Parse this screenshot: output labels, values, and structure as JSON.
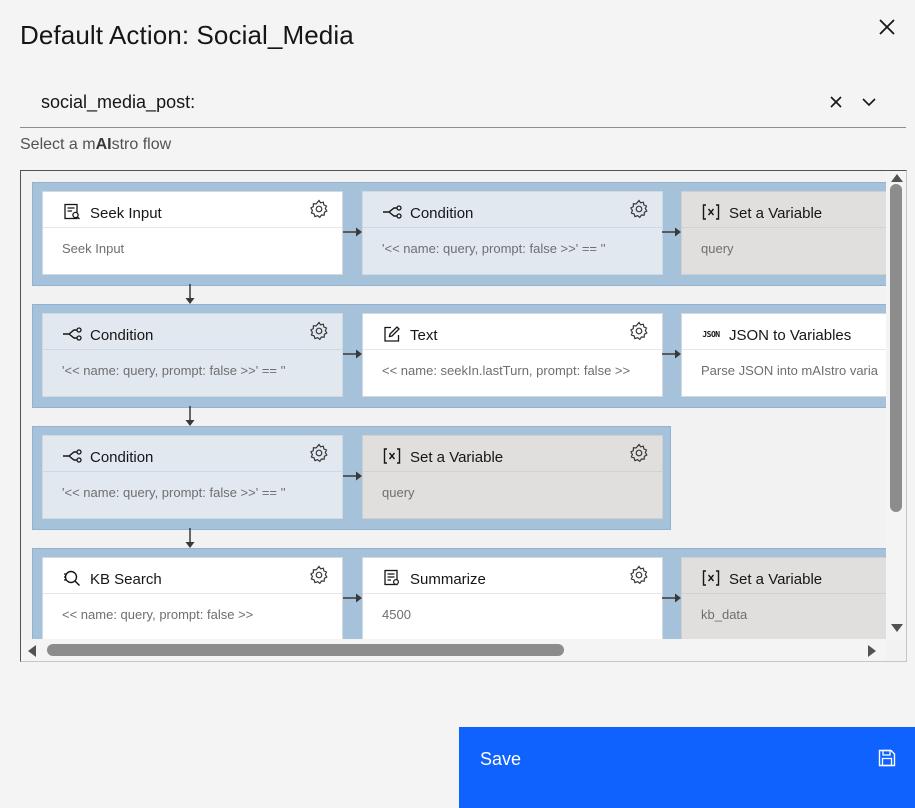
{
  "dialog": {
    "title": "Default Action: Social_Media"
  },
  "dropdown": {
    "value": "social_media_post:"
  },
  "helper": {
    "prefix": "Select a m",
    "brand": "AI",
    "suffix": "stro flow"
  },
  "flow": {
    "rows": [
      {
        "cards": [
          {
            "type": "seek",
            "icon": "seek-input-icon",
            "title": "Seek Input",
            "body": "Seek Input"
          },
          {
            "type": "cond",
            "icon": "branch-icon",
            "title": "Condition",
            "body": "'<< name: query, prompt: false >>' == ''"
          },
          {
            "type": "var",
            "icon": "variable-icon",
            "title": "Set a Variable",
            "body": "query"
          }
        ]
      },
      {
        "cards": [
          {
            "type": "cond",
            "icon": "branch-icon",
            "title": "Condition",
            "body": "'<< name: query, prompt: false >>' == ''"
          },
          {
            "type": "text",
            "icon": "edit-icon",
            "title": "Text",
            "body": "<< name: seekIn.lastTurn, prompt: false >>"
          },
          {
            "type": "json",
            "icon": "json-icon",
            "title": "JSON to Variables",
            "body": "Parse JSON into mAIstro varia"
          }
        ]
      },
      {
        "cards": [
          {
            "type": "cond",
            "icon": "branch-icon",
            "title": "Condition",
            "body": "'<< name: query, prompt: false >>' == ''"
          },
          {
            "type": "var",
            "icon": "variable-icon",
            "title": "Set a Variable",
            "body": "query"
          }
        ]
      },
      {
        "cards": [
          {
            "type": "kb",
            "icon": "kb-search-icon",
            "title": "KB Search",
            "body": "<< name: query, prompt: false >>"
          },
          {
            "type": "sum",
            "icon": "summarize-icon",
            "title": "Summarize",
            "body": "4500"
          },
          {
            "type": "var",
            "icon": "variable-icon",
            "title": "Set a Variable",
            "body": "kb_data"
          }
        ]
      }
    ],
    "json_icon_text": "JSON"
  },
  "footer": {
    "save_label": "Save"
  },
  "colors": {
    "primary": "#0f62fe",
    "row_bg": "#a6c2db",
    "condition_bg": "#e1e8f0",
    "variable_bg": "#e0dfdd"
  }
}
